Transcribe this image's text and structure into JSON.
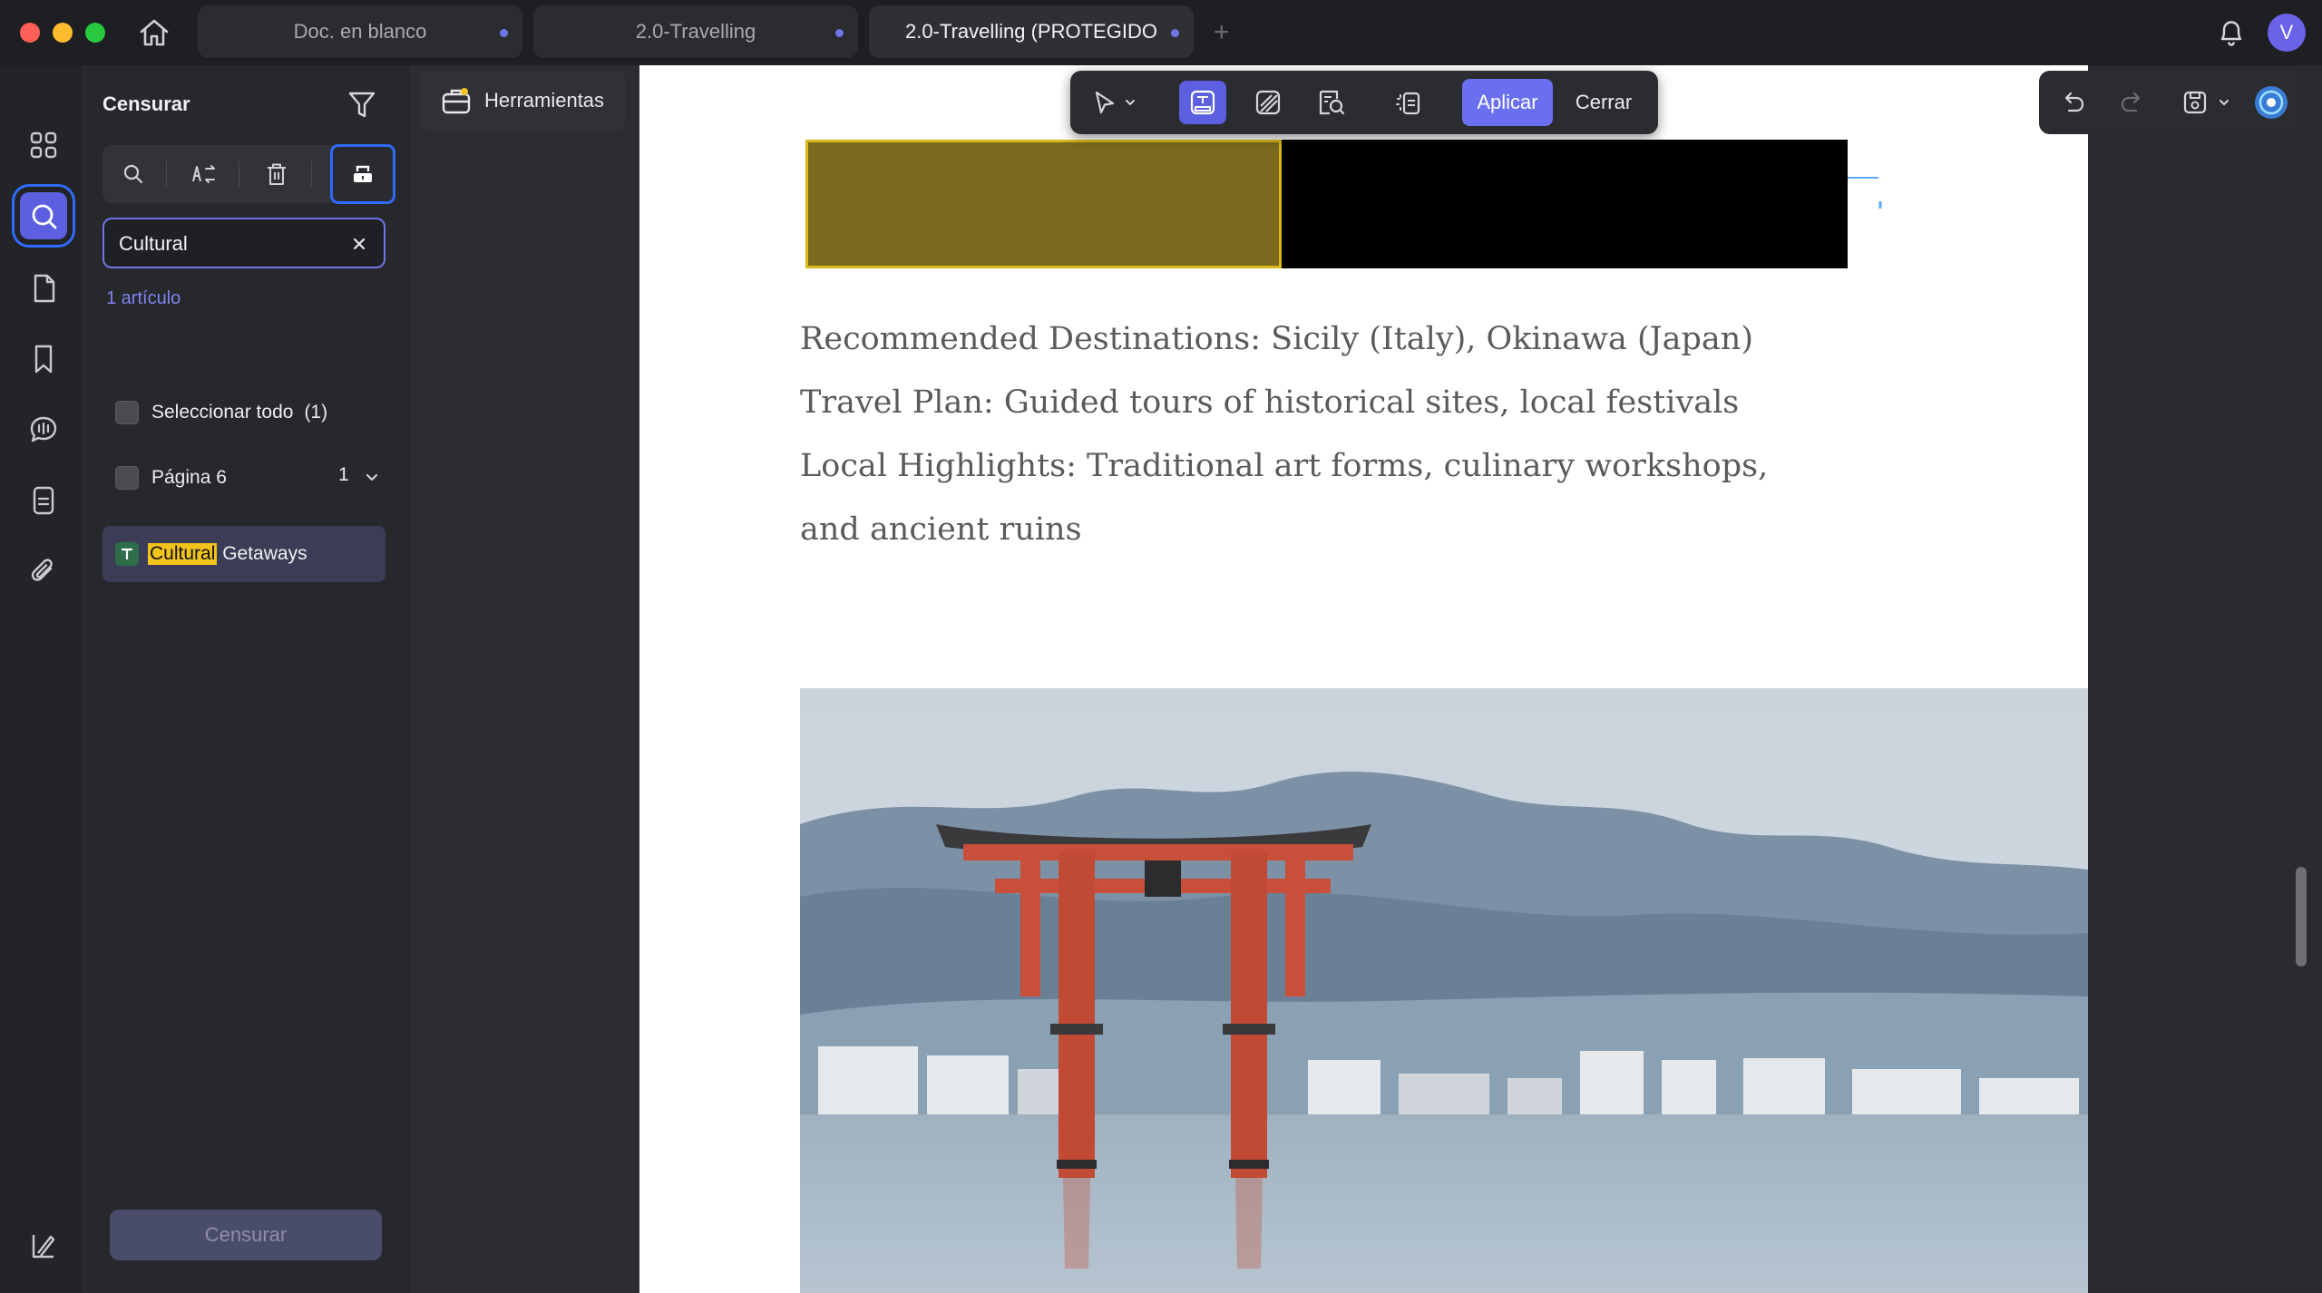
{
  "window": {
    "tabs": [
      {
        "label": "Doc. en blanco",
        "active": false
      },
      {
        "label": "2.0-Travelling",
        "active": false
      },
      {
        "label": "2.0-Travelling (PROTEGIDO",
        "active": true
      }
    ],
    "avatar_initial": "V"
  },
  "panel": {
    "title": "Censurar",
    "search_value": "Cultural",
    "result_count": "1 artículo",
    "select_all_label": "Seleccionar todo",
    "select_all_count": "(1)",
    "page_label": "Página 6",
    "page_count": "1",
    "result": {
      "highlight": "Cultural",
      "rest": " Getaways"
    },
    "censor_button": "Censurar"
  },
  "tools_button": "Herramientas",
  "redact_toolbar": {
    "apply": "Aplicar",
    "close": "Cerrar"
  },
  "document": {
    "lines": [
      "Recommended Destinations: Sicily (Italy), Okinawa (Japan)",
      "Travel Plan: Guided tours of historical sites, local festivals",
      "Local Highlights: Traditional art forms, culinary workshops,",
      "and ancient ruins"
    ]
  },
  "colors": {
    "accent": "#5b5fe0",
    "highlight_outline": "#2f6bff",
    "redact_fill": "#7b6a1e",
    "search_highlight": "#f2c31a"
  }
}
